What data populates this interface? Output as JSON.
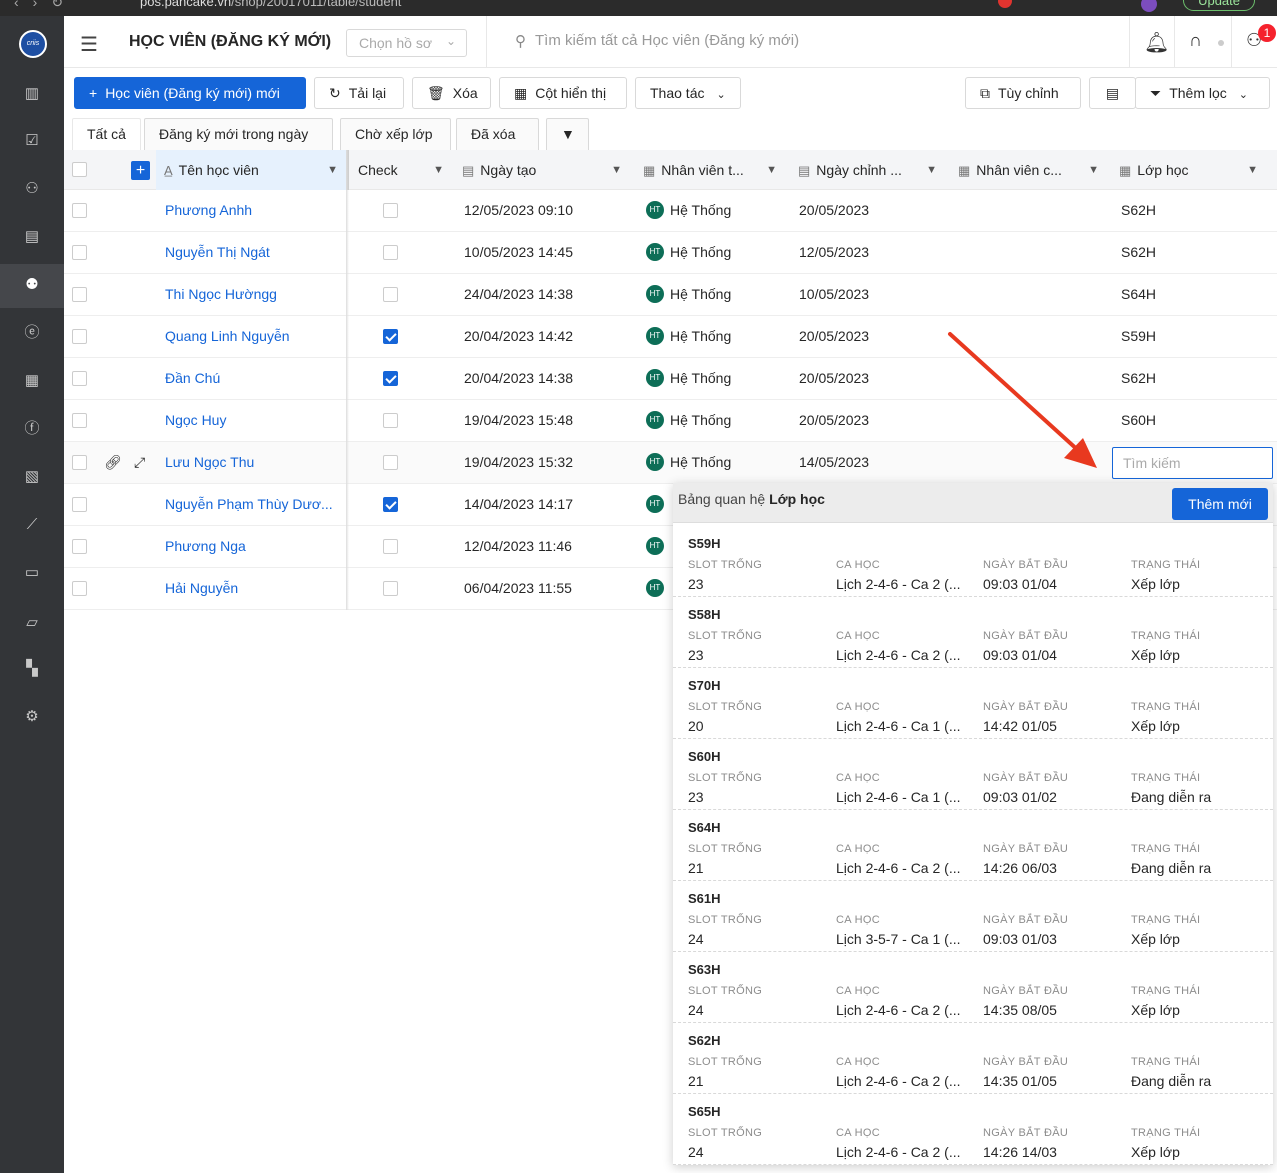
{
  "browser": {
    "url_host": "pos.pancake.vn",
    "url_path": "/shop/20017011/table/student",
    "update_label": "Update"
  },
  "header": {
    "title": "HỌC VIÊN (ĐĂNG KÝ MỚI)",
    "profile_placeholder": "Chọn hồ sơ",
    "search_placeholder": "Tìm kiếm tất cả Học viên (Đăng ký mới)",
    "notification_count": "1"
  },
  "toolbar": {
    "new_label": "Học viên (Đăng ký mới) mới",
    "reload_label": "Tải lại",
    "delete_label": "Xóa",
    "columns_label": "Cột hiển thị",
    "actions_label": "Thao tác",
    "customize_label": "Tùy chỉnh",
    "filter_label": "Thêm lọc"
  },
  "tabs": [
    "Tất cả",
    "Đăng ký mới trong ngày",
    "Chờ xếp lớp",
    "Đã xóa"
  ],
  "columns": {
    "name": "Tên học viên",
    "check": "Check",
    "created": "Ngày tạo",
    "staff_created": "Nhân viên t...",
    "edited": "Ngày chỉnh ...",
    "staff_edited": "Nhân viên c...",
    "class": "Lớp học"
  },
  "rows": [
    {
      "name": "Phương Anhh",
      "checked": false,
      "created": "12/05/2023 09:10",
      "staff": "Hệ Thống",
      "edited": "20/05/2023",
      "class": "S62H"
    },
    {
      "name": "Nguyễn Thị Ngát",
      "checked": false,
      "created": "10/05/2023 14:45",
      "staff": "Hệ Thống",
      "edited": "12/05/2023",
      "class": "S62H"
    },
    {
      "name": "Thi Ngọc Hườngg",
      "checked": false,
      "created": "24/04/2023 14:38",
      "staff": "Hệ Thống",
      "edited": "10/05/2023",
      "class": "S64H"
    },
    {
      "name": "Quang Linh Nguyễn",
      "checked": true,
      "created": "20/04/2023 14:42",
      "staff": "Hệ Thống",
      "edited": "20/05/2023",
      "class": "S59H"
    },
    {
      "name": "Đần Chú",
      "checked": true,
      "created": "20/04/2023 14:38",
      "staff": "Hệ Thống",
      "edited": "20/05/2023",
      "class": "S62H"
    },
    {
      "name": "Ngọc Huy",
      "checked": false,
      "created": "19/04/2023 15:48",
      "staff": "Hệ Thống",
      "edited": "20/05/2023",
      "class": "S60H"
    },
    {
      "name": "Lưu Ngọc Thu",
      "checked": false,
      "created": "19/04/2023 15:32",
      "staff": "Hệ Thống",
      "edited": "14/05/2023",
      "class": ""
    },
    {
      "name": "Nguyễn Phạm Thùy Dươ...",
      "checked": true,
      "created": "14/04/2023 14:17",
      "staff": "",
      "edited": "",
      "class": ""
    },
    {
      "name": "Phương Nga",
      "checked": false,
      "created": "12/04/2023 11:46",
      "staff": "",
      "edited": "",
      "class": ""
    },
    {
      "name": "Hải Nguyễn",
      "checked": false,
      "created": "06/04/2023 11:55",
      "staff": "",
      "edited": "",
      "class": ""
    }
  ],
  "avatar_initials": "HT",
  "cell_search_placeholder": "Tìm kiếm",
  "relation_panel": {
    "title_prefix": "Bảng quan hệ",
    "title_entity": "Lớp học",
    "add_label": "Thêm mới",
    "labels": {
      "slots": "SLOT TRỐNG",
      "shift": "CA HỌC",
      "start": "NGÀY BẮT ĐẦU",
      "status": "TRẠNG THÁI"
    },
    "items": [
      {
        "code": "S59H",
        "slots": "23",
        "shift": "Lịch 2-4-6 - Ca 2 (...",
        "start": "09:03 01/04",
        "status": "Xếp lớp"
      },
      {
        "code": "S58H",
        "slots": "23",
        "shift": "Lịch 2-4-6 - Ca 2 (...",
        "start": "09:03 01/04",
        "status": "Xếp lớp"
      },
      {
        "code": "S70H",
        "slots": "20",
        "shift": "Lịch 2-4-6 - Ca 1 (...",
        "start": "14:42 01/05",
        "status": "Xếp lớp"
      },
      {
        "code": "S60H",
        "slots": "23",
        "shift": "Lịch 2-4-6 - Ca 1 (...",
        "start": "09:03 01/02",
        "status": "Đang diễn ra"
      },
      {
        "code": "S64H",
        "slots": "21",
        "shift": "Lịch 2-4-6 - Ca 2 (...",
        "start": "14:26 06/03",
        "status": "Đang diễn ra"
      },
      {
        "code": "S61H",
        "slots": "24",
        "shift": "Lịch 3-5-7 - Ca 1 (...",
        "start": "09:03 01/03",
        "status": "Xếp lớp"
      },
      {
        "code": "S63H",
        "slots": "24",
        "shift": "Lịch 2-4-6 - Ca 2 (...",
        "start": "14:35 08/05",
        "status": "Xếp lớp"
      },
      {
        "code": "S62H",
        "slots": "21",
        "shift": "Lịch 2-4-6 - Ca 2 (...",
        "start": "14:35 01/05",
        "status": "Đang diễn ra"
      },
      {
        "code": "S65H",
        "slots": "24",
        "shift": "Lịch 2-4-6 - Ca 2 (...",
        "start": "14:26 14/03",
        "status": "Xếp lớp"
      }
    ]
  },
  "colors": {
    "primary": "#1565d8",
    "sidebar": "#333538",
    "annotation_arrow": "#e8391f"
  }
}
